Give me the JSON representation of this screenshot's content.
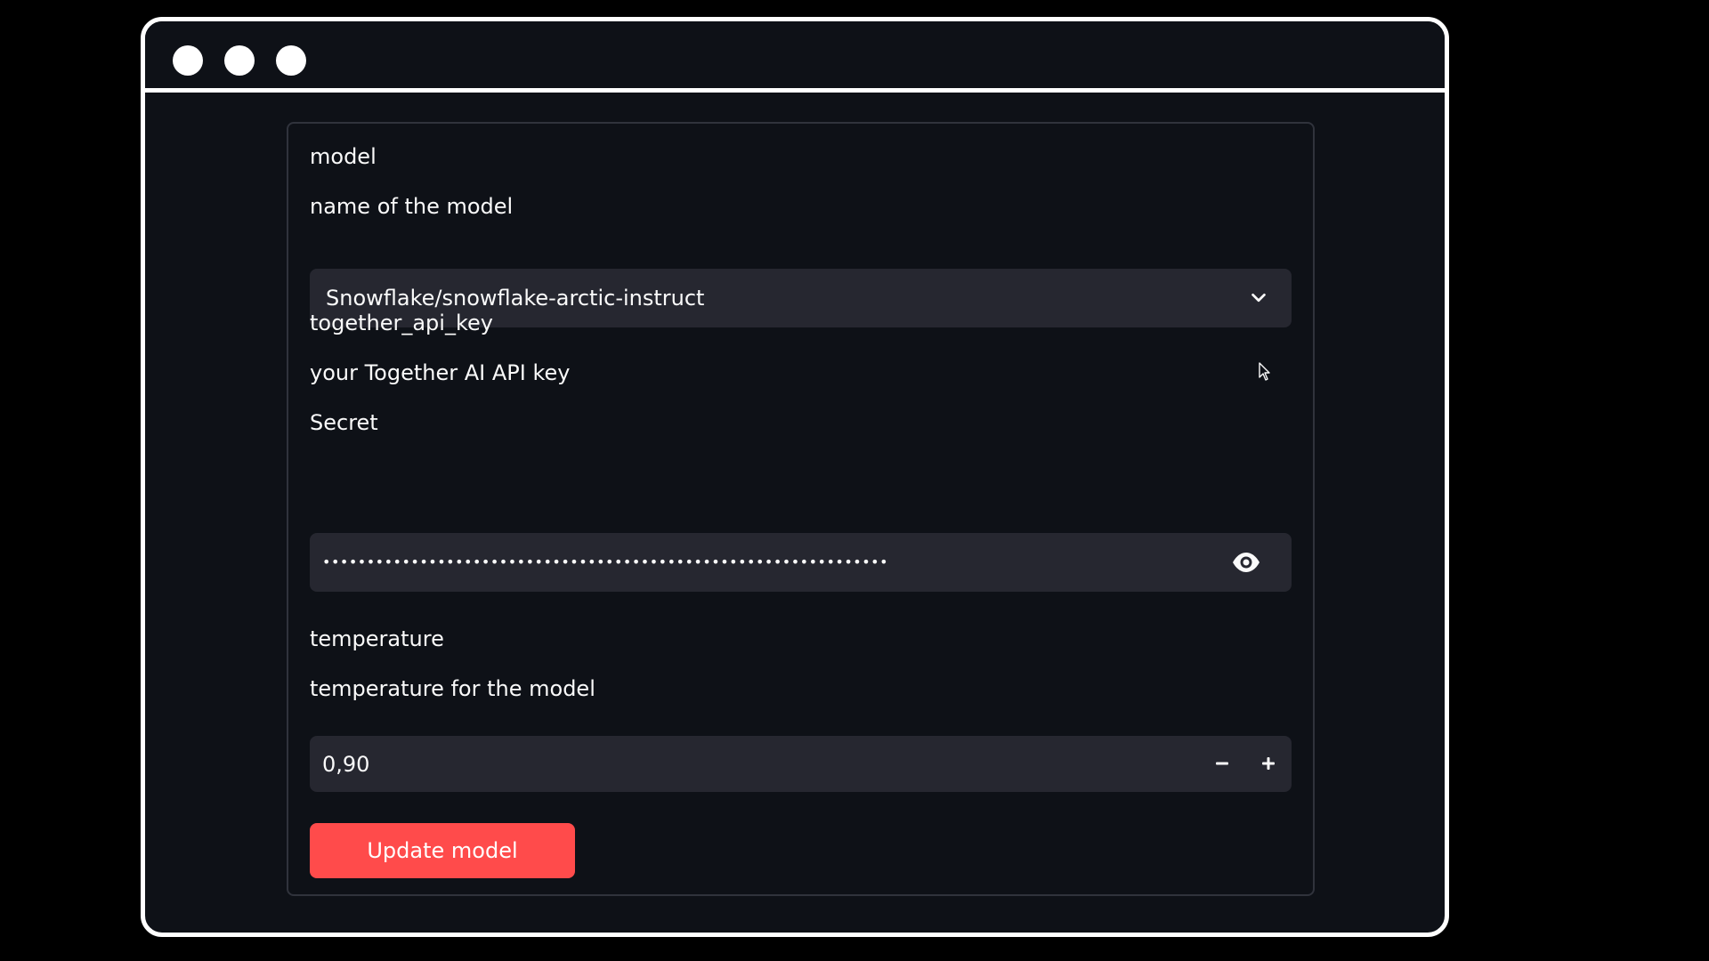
{
  "form": {
    "model_label": "model",
    "model_help": "name of the model",
    "model_selected": "Snowflake/snowflake-arctic-instruct",
    "api_key_label": "together_api_key",
    "api_key_help": "your Together AI API key",
    "secret_label": "Secret",
    "api_key_masked_value": "••••••••••••••••••••••••••••••••••••••••••••••••••••••••••••••••",
    "temperature_label": "temperature",
    "temperature_help": "temperature for the model",
    "temperature_value": "0,90",
    "update_button_label": "Update model"
  },
  "icons": {
    "select_chevron": "chevron-down-icon",
    "password_toggle": "eye-icon",
    "decrement": "minus-icon",
    "increment": "plus-icon",
    "pointer": "mouse-cursor-icon"
  },
  "colors": {
    "page_background": "#000000",
    "window_background": "#0e1117",
    "window_border": "#ffffff",
    "card_border": "#30333c",
    "input_background": "#262730",
    "text_primary": "#fafafa",
    "primary_button": "#ff4b4b"
  }
}
